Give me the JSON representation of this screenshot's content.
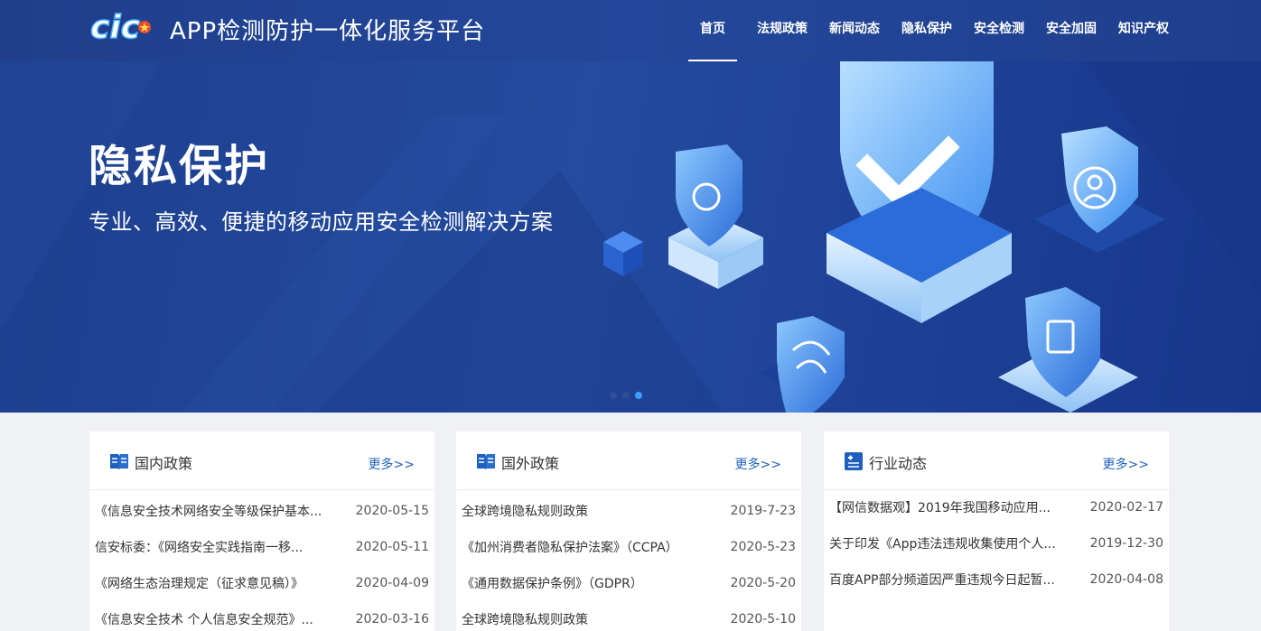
{
  "header": {
    "title": "APP检测防护一体化服务平台",
    "logo_text": "cic",
    "nav": [
      {
        "label": "首页",
        "active": true
      },
      {
        "label": "法规政策"
      },
      {
        "label": "新闻动态"
      },
      {
        "label": "隐私保护"
      },
      {
        "label": "安全检测"
      },
      {
        "label": "安全加固"
      },
      {
        "label": "知识产权"
      }
    ]
  },
  "banner": {
    "title": "隐私保护",
    "subtitle": "专业、高效、便捷的移动应用安全检测解决方案",
    "slide_count": 3,
    "active_slide": 3
  },
  "panels": [
    {
      "title": "国内政策",
      "icon": "book-icon",
      "more": "更多>>",
      "rows": [
        {
          "title": "《信息安全技术网络安全等级保护基本...",
          "date": "2020-05-15"
        },
        {
          "title": "信安标委：《网络安全实践指南一移...",
          "date": "2020-05-11"
        },
        {
          "title": "《网络生态治理规定（征求意见稿）》",
          "date": "2020-04-09"
        },
        {
          "title": "《信息安全技术 个人信息安全规范》...",
          "date": "2020-03-16"
        }
      ]
    },
    {
      "title": "国外政策",
      "icon": "book-icon",
      "more": "更多>>",
      "rows": [
        {
          "title": "全球跨境隐私规则政策",
          "date": "2019-7-23"
        },
        {
          "title": "《加州消费者隐私保护法案》（CCPA）",
          "date": "2020-5-23"
        },
        {
          "title": "《通用数据保护条例》（GDPR）",
          "date": "2020-5-20"
        },
        {
          "title": "全球跨境隐私规则政策",
          "date": "2020-5-10"
        }
      ]
    },
    {
      "title": "行业动态",
      "icon": "news-list-icon",
      "more": "更多>>",
      "rows": [
        {
          "title": "【网信数据观】2019年我国移动应用...",
          "date": "2020-02-17"
        },
        {
          "title": "关于印发《App违法违规收集使用个人...",
          "date": "2019-12-30"
        },
        {
          "title": "百度APP部分频道因严重违规今日起暂...",
          "date": "2020-04-08"
        }
      ]
    }
  ],
  "colors": {
    "header_bg": "#23479a",
    "banner_bg": "#1d3f8e",
    "link": "#1f5fc0",
    "dot_active": "#3aa0ff"
  }
}
